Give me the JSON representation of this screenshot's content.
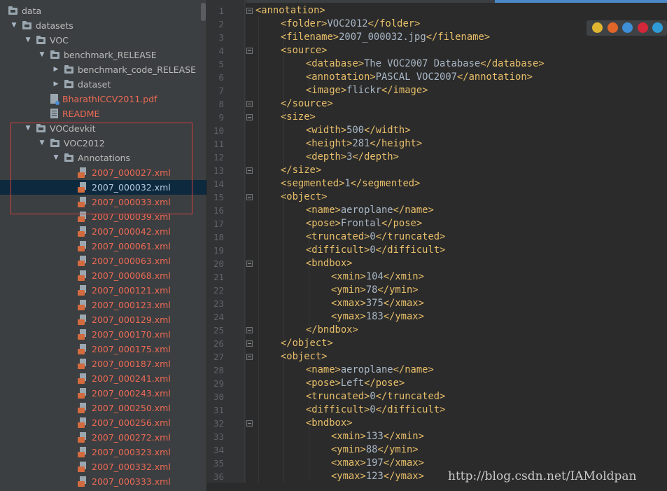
{
  "tree": {
    "rows": [
      {
        "label": "data",
        "type": "folder",
        "indent": 0,
        "arrow": "",
        "color": "normal"
      },
      {
        "label": "datasets",
        "type": "folder",
        "indent": 1,
        "arrow": "down",
        "color": "normal"
      },
      {
        "label": "VOC",
        "type": "folder",
        "indent": 2,
        "arrow": "down",
        "color": "normal"
      },
      {
        "label": "benchmark_RELEASE",
        "type": "folder",
        "indent": 3,
        "arrow": "down",
        "color": "normal"
      },
      {
        "label": "benchmark_code_RELEASE",
        "type": "folder",
        "indent": 4,
        "arrow": "right",
        "color": "normal"
      },
      {
        "label": "dataset",
        "type": "folder",
        "indent": 4,
        "arrow": "right",
        "color": "normal"
      },
      {
        "label": "BharathICCV2011.pdf",
        "type": "pdf",
        "indent": 4,
        "arrow": "",
        "color": "red"
      },
      {
        "label": "README",
        "type": "readme",
        "indent": 4,
        "arrow": "",
        "color": "red"
      },
      {
        "label": "VOCdevkit",
        "type": "folder",
        "indent": 2,
        "arrow": "down",
        "color": "normal"
      },
      {
        "label": "VOC2012",
        "type": "folder",
        "indent": 3,
        "arrow": "down",
        "color": "normal"
      },
      {
        "label": "Annotations",
        "type": "folder",
        "indent": 4,
        "arrow": "down",
        "color": "normal"
      },
      {
        "label": "2007_000027.xml",
        "type": "xml",
        "indent": 5,
        "arrow": "",
        "color": "red"
      },
      {
        "label": "2007_000032.xml",
        "type": "xml",
        "indent": 5,
        "arrow": "",
        "color": "selected"
      },
      {
        "label": "2007_000033.xml",
        "type": "xml",
        "indent": 5,
        "arrow": "",
        "color": "red"
      },
      {
        "label": "2007_000039.xml",
        "type": "xml",
        "indent": 5,
        "arrow": "",
        "color": "red"
      },
      {
        "label": "2007_000042.xml",
        "type": "xml",
        "indent": 5,
        "arrow": "",
        "color": "red"
      },
      {
        "label": "2007_000061.xml",
        "type": "xml",
        "indent": 5,
        "arrow": "",
        "color": "red"
      },
      {
        "label": "2007_000063.xml",
        "type": "xml",
        "indent": 5,
        "arrow": "",
        "color": "red"
      },
      {
        "label": "2007_000068.xml",
        "type": "xml",
        "indent": 5,
        "arrow": "",
        "color": "red"
      },
      {
        "label": "2007_000121.xml",
        "type": "xml",
        "indent": 5,
        "arrow": "",
        "color": "red"
      },
      {
        "label": "2007_000123.xml",
        "type": "xml",
        "indent": 5,
        "arrow": "",
        "color": "red"
      },
      {
        "label": "2007_000129.xml",
        "type": "xml",
        "indent": 5,
        "arrow": "",
        "color": "red"
      },
      {
        "label": "2007_000170.xml",
        "type": "xml",
        "indent": 5,
        "arrow": "",
        "color": "red"
      },
      {
        "label": "2007_000175.xml",
        "type": "xml",
        "indent": 5,
        "arrow": "",
        "color": "red"
      },
      {
        "label": "2007_000187.xml",
        "type": "xml",
        "indent": 5,
        "arrow": "",
        "color": "red"
      },
      {
        "label": "2007_000241.xml",
        "type": "xml",
        "indent": 5,
        "arrow": "",
        "color": "red"
      },
      {
        "label": "2007_000243.xml",
        "type": "xml",
        "indent": 5,
        "arrow": "",
        "color": "red"
      },
      {
        "label": "2007_000250.xml",
        "type": "xml",
        "indent": 5,
        "arrow": "",
        "color": "red"
      },
      {
        "label": "2007_000256.xml",
        "type": "xml",
        "indent": 5,
        "arrow": "",
        "color": "red"
      },
      {
        "label": "2007_000272.xml",
        "type": "xml",
        "indent": 5,
        "arrow": "",
        "color": "red"
      },
      {
        "label": "2007_000323.xml",
        "type": "xml",
        "indent": 5,
        "arrow": "",
        "color": "red"
      },
      {
        "label": "2007_000332.xml",
        "type": "xml",
        "indent": 5,
        "arrow": "",
        "color": "red"
      },
      {
        "label": "2007_000333.xml",
        "type": "xml",
        "indent": 5,
        "arrow": "",
        "color": "red"
      }
    ]
  },
  "editor": {
    "lines": [
      {
        "n": "1",
        "indent": 0,
        "fold": true,
        "parts": [
          [
            "t",
            "<annotation>"
          ]
        ]
      },
      {
        "n": "2",
        "indent": 1,
        "fold": false,
        "parts": [
          [
            "t",
            "<folder>"
          ],
          [
            "v",
            "VOC2012"
          ],
          [
            "t",
            "</folder>"
          ]
        ]
      },
      {
        "n": "3",
        "indent": 1,
        "fold": false,
        "parts": [
          [
            "t",
            "<filename>"
          ],
          [
            "v",
            "2007_000032.jpg"
          ],
          [
            "t",
            "</filename>"
          ]
        ]
      },
      {
        "n": "4",
        "indent": 1,
        "fold": true,
        "parts": [
          [
            "t",
            "<source>"
          ]
        ]
      },
      {
        "n": "5",
        "indent": 2,
        "fold": false,
        "parts": [
          [
            "t",
            "<database>"
          ],
          [
            "v",
            "The VOC2007 Database"
          ],
          [
            "t",
            "</database>"
          ]
        ]
      },
      {
        "n": "6",
        "indent": 2,
        "fold": false,
        "parts": [
          [
            "t",
            "<annotation>"
          ],
          [
            "v",
            "PASCAL VOC2007"
          ],
          [
            "t",
            "</annotation>"
          ]
        ]
      },
      {
        "n": "7",
        "indent": 2,
        "fold": false,
        "parts": [
          [
            "t",
            "<image>"
          ],
          [
            "v",
            "flickr"
          ],
          [
            "t",
            "</image>"
          ]
        ]
      },
      {
        "n": "8",
        "indent": 1,
        "fold": true,
        "parts": [
          [
            "t",
            "</source>"
          ]
        ]
      },
      {
        "n": "9",
        "indent": 1,
        "fold": true,
        "parts": [
          [
            "t",
            "<size>"
          ]
        ]
      },
      {
        "n": "10",
        "indent": 2,
        "fold": false,
        "parts": [
          [
            "t",
            "<width>"
          ],
          [
            "v",
            "500"
          ],
          [
            "t",
            "</width>"
          ]
        ]
      },
      {
        "n": "11",
        "indent": 2,
        "fold": false,
        "parts": [
          [
            "t",
            "<height>"
          ],
          [
            "v",
            "281"
          ],
          [
            "t",
            "</height>"
          ]
        ]
      },
      {
        "n": "12",
        "indent": 2,
        "fold": false,
        "parts": [
          [
            "t",
            "<depth>"
          ],
          [
            "v",
            "3"
          ],
          [
            "t",
            "</depth>"
          ]
        ]
      },
      {
        "n": "13",
        "indent": 1,
        "fold": true,
        "parts": [
          [
            "t",
            "</size>"
          ]
        ]
      },
      {
        "n": "14",
        "indent": 1,
        "fold": false,
        "parts": [
          [
            "t",
            "<segmented>"
          ],
          [
            "v",
            "1"
          ],
          [
            "t",
            "</segmented>"
          ]
        ]
      },
      {
        "n": "15",
        "indent": 1,
        "fold": true,
        "parts": [
          [
            "t",
            "<object>"
          ]
        ]
      },
      {
        "n": "16",
        "indent": 2,
        "fold": false,
        "parts": [
          [
            "t",
            "<name>"
          ],
          [
            "v",
            "aeroplane"
          ],
          [
            "t",
            "</name>"
          ]
        ]
      },
      {
        "n": "17",
        "indent": 2,
        "fold": false,
        "parts": [
          [
            "t",
            "<pose>"
          ],
          [
            "v",
            "Frontal"
          ],
          [
            "t",
            "</pose>"
          ]
        ]
      },
      {
        "n": "18",
        "indent": 2,
        "fold": false,
        "parts": [
          [
            "t",
            "<truncated>"
          ],
          [
            "v",
            "0"
          ],
          [
            "t",
            "</truncated>"
          ]
        ]
      },
      {
        "n": "19",
        "indent": 2,
        "fold": false,
        "parts": [
          [
            "t",
            "<difficult>"
          ],
          [
            "v",
            "0"
          ],
          [
            "t",
            "</difficult>"
          ]
        ]
      },
      {
        "n": "20",
        "indent": 2,
        "fold": true,
        "parts": [
          [
            "t",
            "<bndbox>"
          ]
        ]
      },
      {
        "n": "21",
        "indent": 3,
        "fold": false,
        "parts": [
          [
            "t",
            "<xmin>"
          ],
          [
            "v",
            "104"
          ],
          [
            "t",
            "</xmin>"
          ]
        ]
      },
      {
        "n": "22",
        "indent": 3,
        "fold": false,
        "parts": [
          [
            "t",
            "<ymin>"
          ],
          [
            "v",
            "78"
          ],
          [
            "t",
            "</ymin>"
          ]
        ]
      },
      {
        "n": "23",
        "indent": 3,
        "fold": false,
        "parts": [
          [
            "t",
            "<xmax>"
          ],
          [
            "v",
            "375"
          ],
          [
            "t",
            "</xmax>"
          ]
        ]
      },
      {
        "n": "24",
        "indent": 3,
        "fold": false,
        "parts": [
          [
            "t",
            "<ymax>"
          ],
          [
            "v",
            "183"
          ],
          [
            "t",
            "</ymax>"
          ]
        ]
      },
      {
        "n": "25",
        "indent": 2,
        "fold": true,
        "parts": [
          [
            "t",
            "</bndbox>"
          ]
        ]
      },
      {
        "n": "26",
        "indent": 1,
        "fold": true,
        "parts": [
          [
            "t",
            "</object>"
          ]
        ]
      },
      {
        "n": "27",
        "indent": 1,
        "fold": true,
        "parts": [
          [
            "t",
            "<object>"
          ]
        ]
      },
      {
        "n": "28",
        "indent": 2,
        "fold": false,
        "parts": [
          [
            "t",
            "<name>"
          ],
          [
            "v",
            "aeroplane"
          ],
          [
            "t",
            "</name>"
          ]
        ]
      },
      {
        "n": "29",
        "indent": 2,
        "fold": false,
        "parts": [
          [
            "t",
            "<pose>"
          ],
          [
            "v",
            "Left"
          ],
          [
            "t",
            "</pose>"
          ]
        ]
      },
      {
        "n": "30",
        "indent": 2,
        "fold": false,
        "parts": [
          [
            "t",
            "<truncated>"
          ],
          [
            "v",
            "0"
          ],
          [
            "t",
            "</truncated>"
          ]
        ]
      },
      {
        "n": "31",
        "indent": 2,
        "fold": false,
        "parts": [
          [
            "t",
            "<difficult>"
          ],
          [
            "v",
            "0"
          ],
          [
            "t",
            "</difficult>"
          ]
        ]
      },
      {
        "n": "32",
        "indent": 2,
        "fold": true,
        "parts": [
          [
            "t",
            "<bndbox>"
          ]
        ]
      },
      {
        "n": "33",
        "indent": 3,
        "fold": false,
        "parts": [
          [
            "t",
            "<xmin>"
          ],
          [
            "v",
            "133"
          ],
          [
            "t",
            "</xmin>"
          ]
        ]
      },
      {
        "n": "34",
        "indent": 3,
        "fold": false,
        "parts": [
          [
            "t",
            "<ymin>"
          ],
          [
            "v",
            "88"
          ],
          [
            "t",
            "</ymin>"
          ]
        ]
      },
      {
        "n": "35",
        "indent": 3,
        "fold": false,
        "parts": [
          [
            "t",
            "<xmax>"
          ],
          [
            "v",
            "197"
          ],
          [
            "t",
            "</xmax>"
          ]
        ]
      },
      {
        "n": "36",
        "indent": 3,
        "fold": false,
        "parts": [
          [
            "t",
            "<ymax>"
          ],
          [
            "v",
            "123"
          ],
          [
            "t",
            "</ymax>"
          ]
        ]
      }
    ]
  },
  "browser_icons": [
    "chrome-icon",
    "firefox-icon",
    "safari-icon",
    "opera-icon",
    "ie-icon"
  ],
  "watermark": "http://blog.csdn.net/IAMoldpan",
  "colors": {
    "tag": "#e8bf6a",
    "text": "#a9b7c6",
    "red_file": "#ec6955",
    "highlight_box": "#d0403c",
    "selection": "#0d293e"
  }
}
